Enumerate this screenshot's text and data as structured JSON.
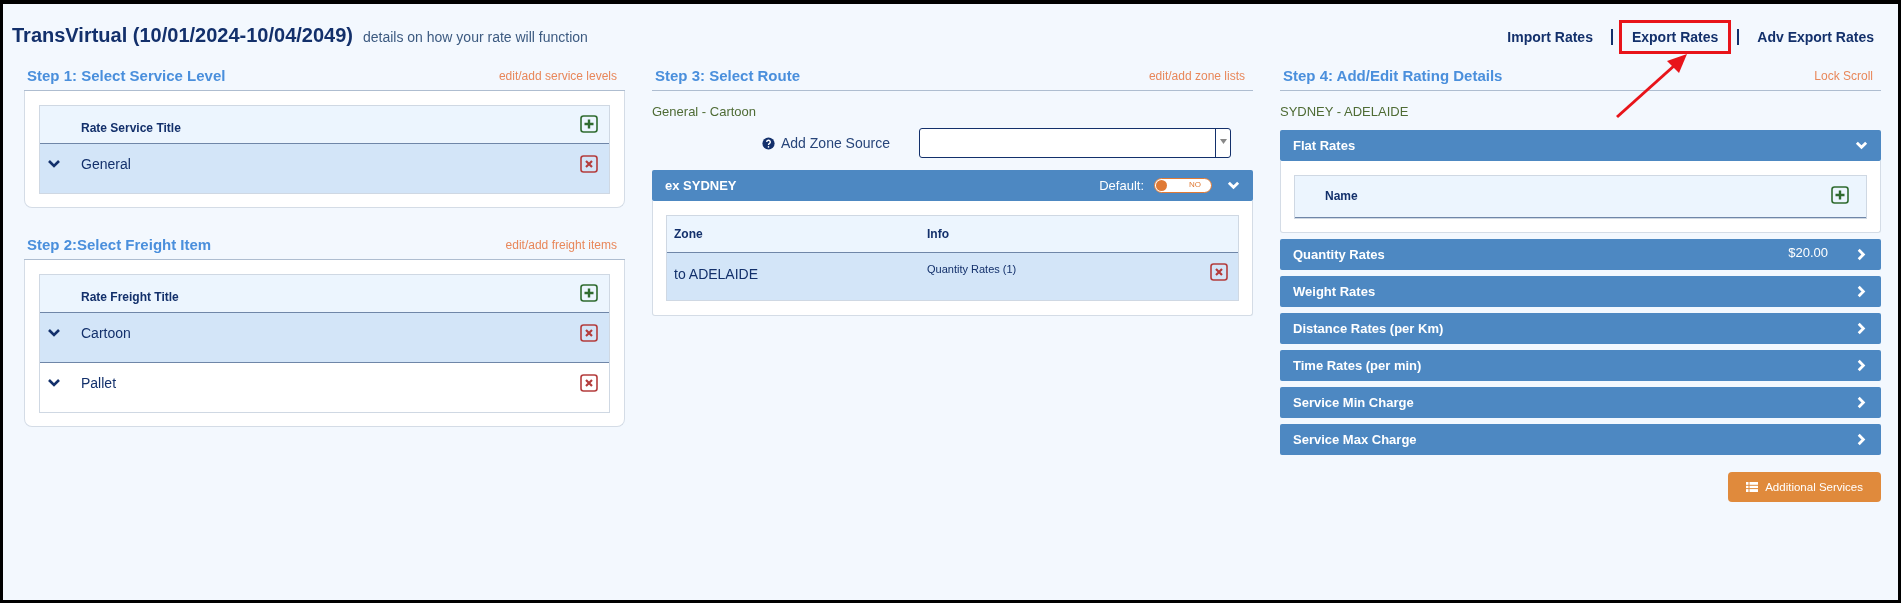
{
  "header": {
    "title": "TransVirtual (10/01/2024-10/04/2049)",
    "subtitle": "details on how your rate will function"
  },
  "top_links": [
    {
      "label": "Import Rates",
      "highlighted": false
    },
    {
      "label": "Export Rates",
      "highlighted": true
    },
    {
      "label": "Adv Export Rates",
      "highlighted": false
    }
  ],
  "step1": {
    "title": "Step 1: Select Service Level",
    "link": "edit/add service levels",
    "column": "Rate Service Title",
    "rows": [
      {
        "label": "General",
        "selected": true
      }
    ]
  },
  "step2": {
    "title": "Step 2:Select Freight Item",
    "link": "edit/add freight items",
    "column": "Rate Freight Title",
    "rows": [
      {
        "label": "Cartoon",
        "selected": true
      },
      {
        "label": "Pallet",
        "selected": false
      }
    ]
  },
  "step3": {
    "title": "Step 3: Select Route",
    "link": "edit/add zone lists",
    "route": "General - Cartoon",
    "zone_source_label": "Add Zone Source",
    "origin": {
      "title": "ex SYDNEY",
      "default_label": "Default:",
      "default_on": false,
      "toggle_text": "NO",
      "expanded": true,
      "columns": [
        "Zone",
        "Info"
      ],
      "rows": [
        {
          "zone": "to ADELAIDE",
          "info": "Quantity Rates (1)",
          "selected": true
        }
      ]
    }
  },
  "step4": {
    "title": "Step 4: Add/Edit Rating Details",
    "link": "Lock Scroll",
    "route": "SYDNEY - ADELAIDE",
    "sections": [
      {
        "label": "Flat Rates",
        "expanded": true,
        "column": "Name"
      },
      {
        "label": "Quantity Rates",
        "amount": "$20.00",
        "expanded": false
      },
      {
        "label": "Weight Rates",
        "expanded": false
      },
      {
        "label": "Distance Rates (per Km)",
        "expanded": false
      },
      {
        "label": "Time Rates (per min)",
        "expanded": false
      },
      {
        "label": "Service Min Charge",
        "expanded": false
      },
      {
        "label": "Service Max Charge",
        "expanded": false
      }
    ],
    "button": "Additional Services"
  }
}
